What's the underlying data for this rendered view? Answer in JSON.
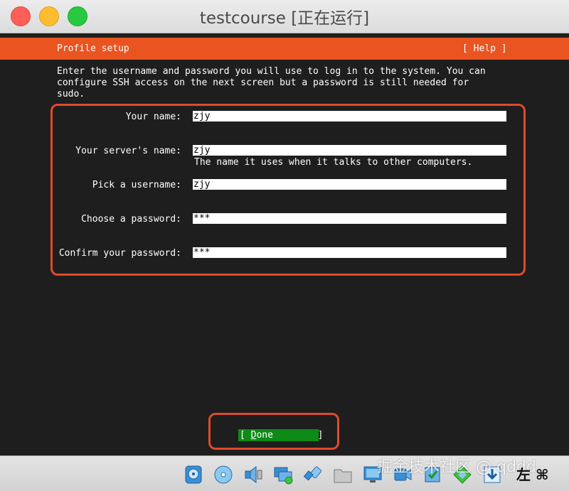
{
  "window": {
    "title": "testcourse [正在运行]"
  },
  "installer": {
    "header_title": "Profile setup",
    "help_label": "[ Help ]",
    "intro_line1": "Enter the username and password you will use to log in to the system. You can",
    "intro_line2": "configure SSH access on the next screen but a password is still needed for",
    "intro_line3": "sudo.",
    "fields": [
      {
        "label": "Your name:",
        "value": "zjy"
      },
      {
        "label": "Your server's name:",
        "value": "zjy",
        "hint": "The name it uses when it talks to other computers."
      },
      {
        "label": "Pick a username:",
        "value": "zjy"
      },
      {
        "label": "Choose a password:",
        "value": "***"
      },
      {
        "label": "Confirm your password:",
        "value": "***"
      }
    ],
    "done_open": "[ ",
    "done_underlined": "D",
    "done_rest": "one",
    "done_close": "]"
  },
  "statusbar": {
    "icons": [
      "hard-disk-icon",
      "optical-disk-icon",
      "audio-icon",
      "network-icon",
      "usb-icon",
      "shared-folder-icon",
      "display-icon",
      "recording-icon",
      "cpu-icon",
      "mouse-integration-icon",
      "download-icon"
    ],
    "host_key": "左 ⌘",
    "watermark": "掘金技术社区 @ qddd"
  },
  "colors": {
    "ubuntu_orange": "#e95420",
    "annotation_red": "#e04a2a",
    "done_green": "#0e8a16",
    "screen_bg": "#1e1e1e"
  }
}
